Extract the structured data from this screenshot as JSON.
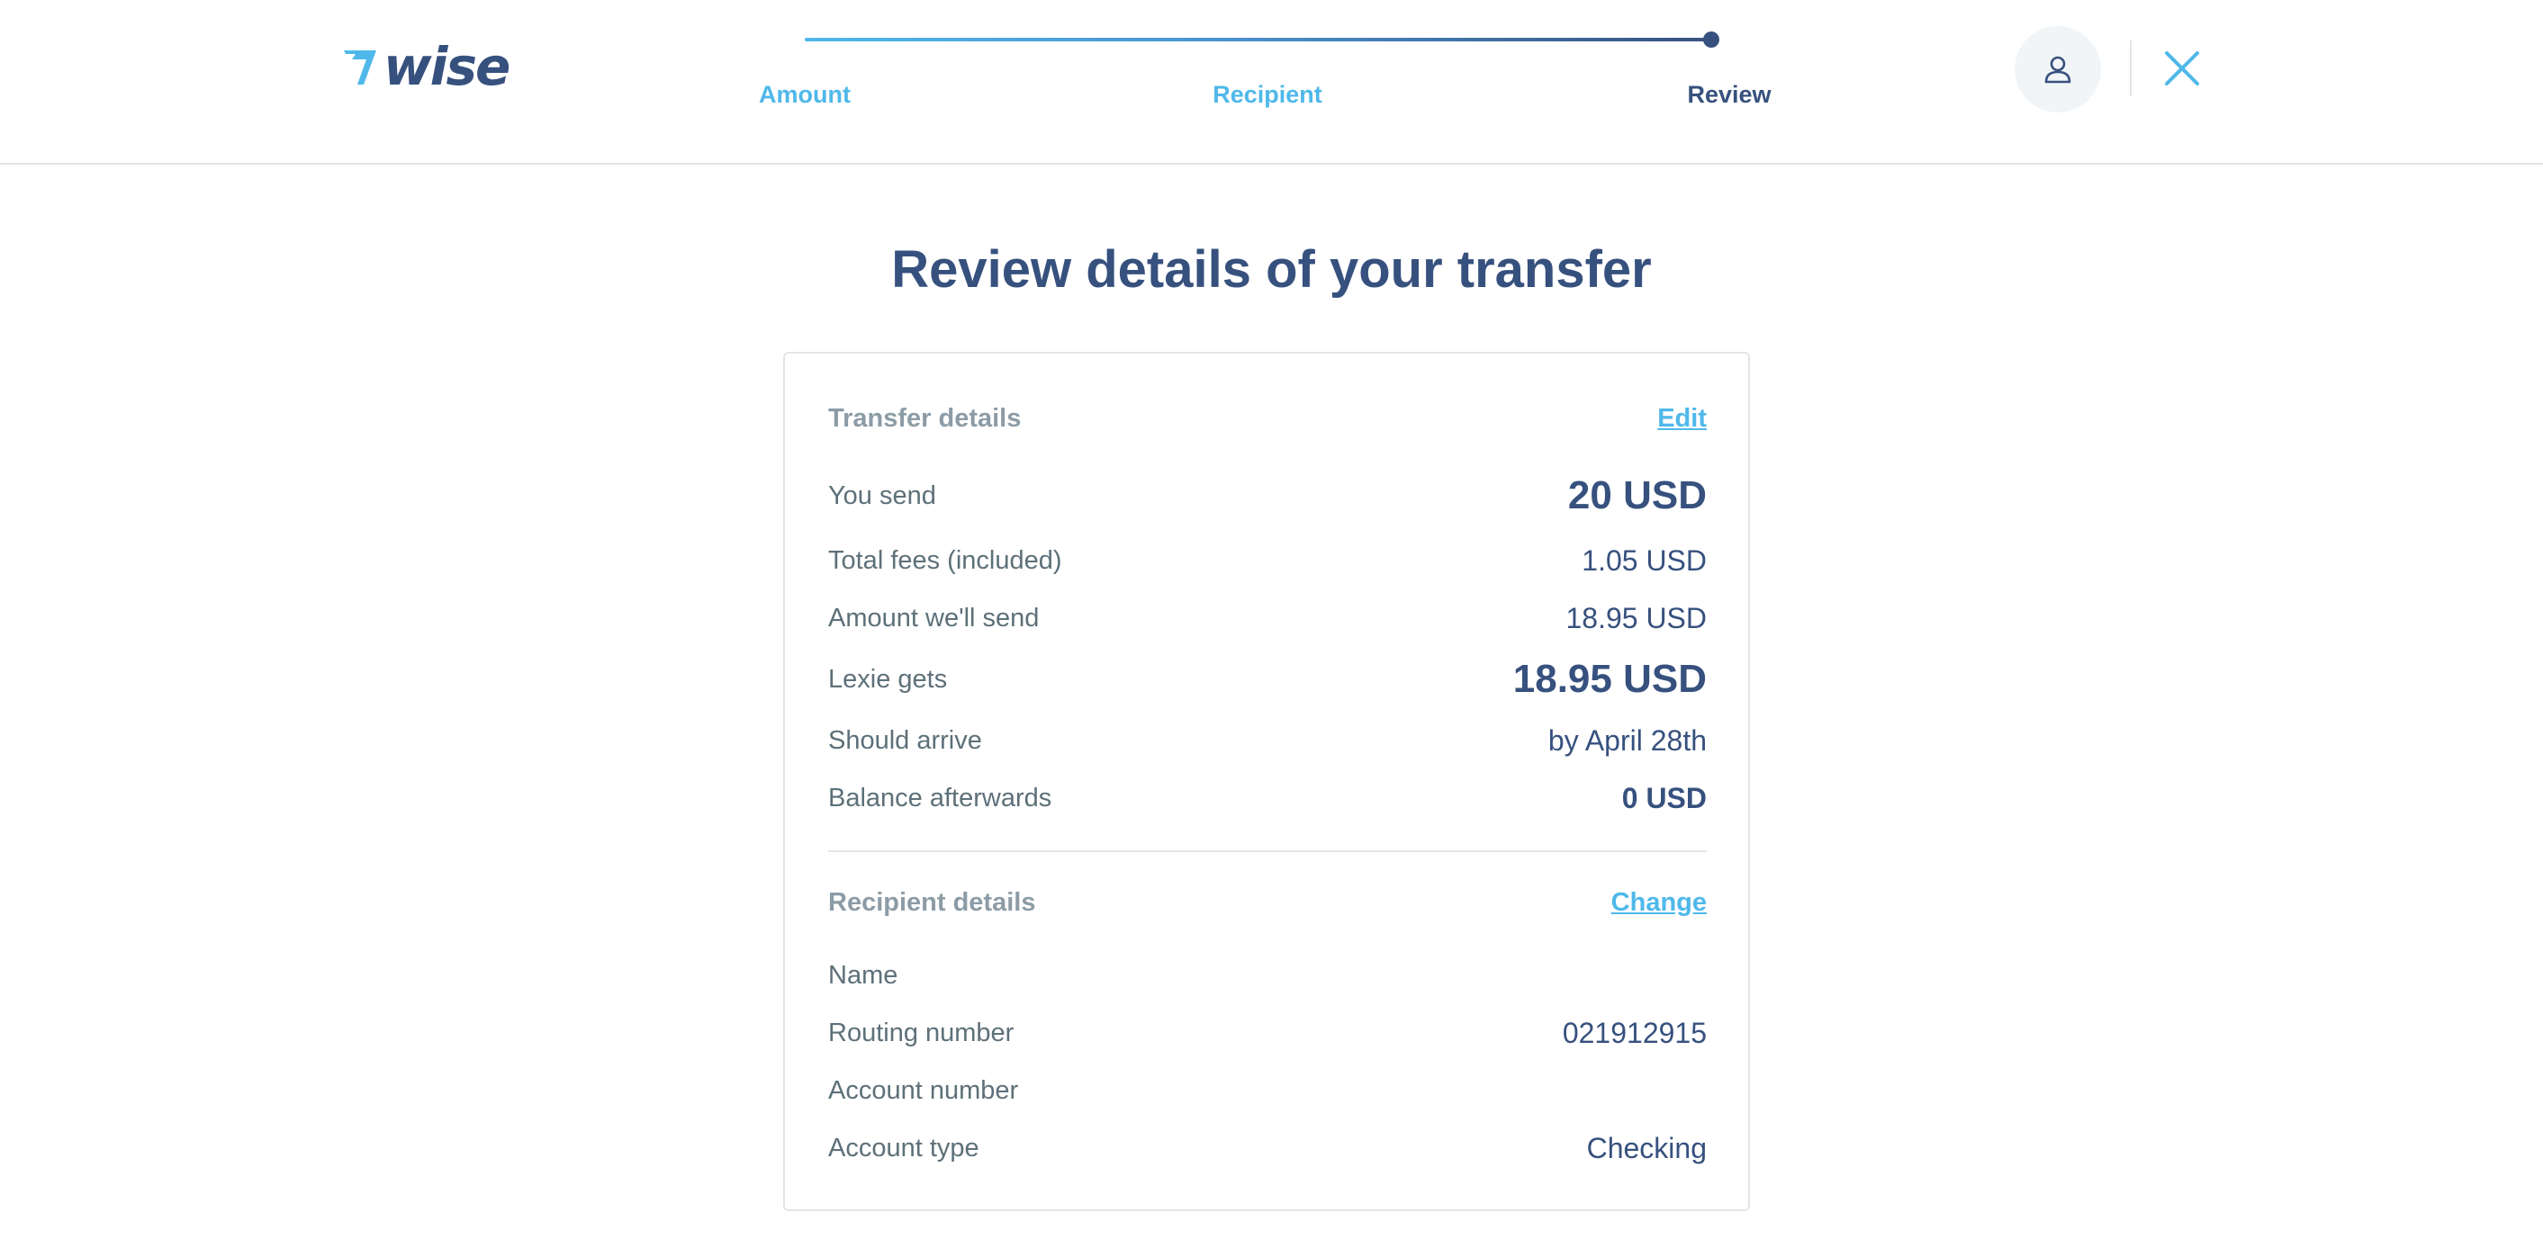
{
  "header": {
    "logo_text": "wise",
    "steps": [
      {
        "label": "Amount",
        "state": "done"
      },
      {
        "label": "Recipient",
        "state": "done"
      },
      {
        "label": "Review",
        "state": "current"
      }
    ],
    "profile_icon": "person-icon",
    "close_icon": "close-icon"
  },
  "main": {
    "title": "Review details of your transfer"
  },
  "transfer": {
    "heading": "Transfer details",
    "edit_label": "Edit",
    "rows": [
      {
        "label": "You send",
        "value": "20 USD"
      },
      {
        "label": "Total fees (included)",
        "value": "1.05 USD"
      },
      {
        "label": "Amount we'll send",
        "value": "18.95 USD"
      },
      {
        "label": "Lexie gets",
        "value": "18.95 USD"
      },
      {
        "label": "Should arrive",
        "value": "by April 28th"
      },
      {
        "label": "Balance afterwards",
        "value": "0 USD"
      }
    ]
  },
  "recipient": {
    "heading": "Recipient details",
    "change_label": "Change",
    "rows": [
      {
        "label": "Name",
        "value": ""
      },
      {
        "label": "Routing number",
        "value": "021912915"
      },
      {
        "label": "Account number",
        "value": ""
      },
      {
        "label": "Account type",
        "value": "Checking"
      }
    ]
  },
  "colors": {
    "brand_navy": "#37517e",
    "accent_blue": "#4fb8ea",
    "muted_text": "#5d7079",
    "border": "#e2e6e8"
  }
}
